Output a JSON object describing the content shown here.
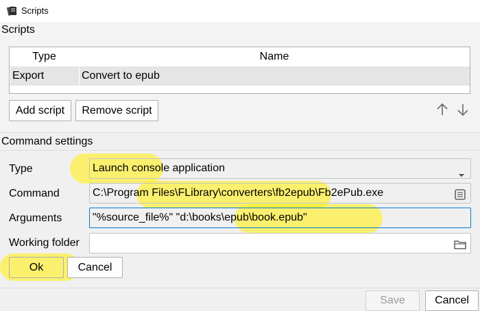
{
  "window": {
    "title": "Scripts"
  },
  "scripts_group": {
    "label": "Scripts",
    "columns": [
      "Type",
      "Name"
    ],
    "rows": [
      {
        "type": "Export",
        "name": "Convert to epub"
      }
    ],
    "add_button": "Add script",
    "remove_button": "Remove script"
  },
  "command_settings": {
    "label": "Command settings",
    "type_label": "Type",
    "type_value": "Launch console application",
    "command_label": "Command",
    "command_value": "C:\\Program Files\\FLibrary\\converters\\fb2epub\\Fb2ePub.exe",
    "arguments_label": "Arguments",
    "arguments_value": "\"%source_file%\" \"d:\\books\\epub\\book.epub\"",
    "working_folder_label": "Working folder",
    "working_folder_value": "",
    "ok_button": "Ok",
    "cancel_button": "Cancel"
  },
  "footer": {
    "save_button": "Save",
    "cancel_button": "Cancel"
  },
  "icons": {
    "app": "book-stack-icon",
    "move_up": "arrow-up-icon",
    "move_down": "arrow-down-icon",
    "command_browse": "file-icon",
    "folder_browse": "folder-icon",
    "combo": "chevron-down-icon"
  },
  "colors": {
    "highlight": "#fff028",
    "focus_border": "#0078d4",
    "selection_row": "#e5e5e5"
  }
}
